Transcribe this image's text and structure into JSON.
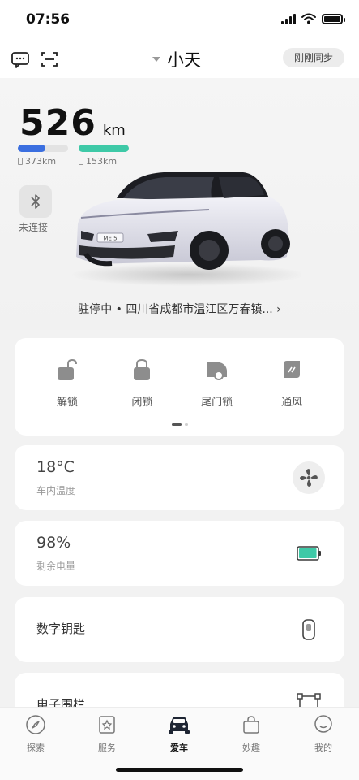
{
  "status_bar": {
    "time": "07:56"
  },
  "nav": {
    "car_name": "小天",
    "sync_label": "刚刚同步"
  },
  "range": {
    "value": "526",
    "unit": "km",
    "fuel": {
      "label": "373km",
      "fraction": 0.55,
      "color": "#3b6fe0"
    },
    "electric": {
      "label": "153km",
      "fraction": 1.0,
      "color": "#3ec9a7"
    }
  },
  "bluetooth": {
    "label": "未连接"
  },
  "location": {
    "text": "驻停中 • 四川省成都市温江区万春镇... ›"
  },
  "car": {
    "badge": "ME 5"
  },
  "quick_controls": [
    {
      "label": "解锁",
      "icon": "unlock-icon"
    },
    {
      "label": "闭锁",
      "icon": "lock-icon"
    },
    {
      "label": "尾门锁",
      "icon": "tailgate-icon"
    },
    {
      "label": "通风",
      "icon": "ventilation-icon"
    }
  ],
  "cards": {
    "temperature": {
      "value": "18°C",
      "label": "车内温度",
      "icon": "fan-icon"
    },
    "battery": {
      "value": "98%",
      "label": "剩余电量",
      "icon": "battery-icon",
      "fraction": 0.98
    },
    "digital_key": {
      "title": "数字钥匙",
      "icon": "key-fob-icon"
    },
    "geofence": {
      "title": "电子围栏",
      "icon": "geofence-icon"
    }
  },
  "tabs": [
    {
      "label": "探索",
      "icon": "compass-icon",
      "active": false
    },
    {
      "label": "服务",
      "icon": "service-icon",
      "active": false
    },
    {
      "label": "爱车",
      "icon": "car-icon",
      "active": true
    },
    {
      "label": "妙趣",
      "icon": "shopping-bag-icon",
      "active": false
    },
    {
      "label": "我的",
      "icon": "profile-icon",
      "active": false
    }
  ],
  "colors": {
    "accent_blue": "#3b6fe0",
    "accent_green": "#3ec9a7",
    "background": "#f2f2f2"
  }
}
